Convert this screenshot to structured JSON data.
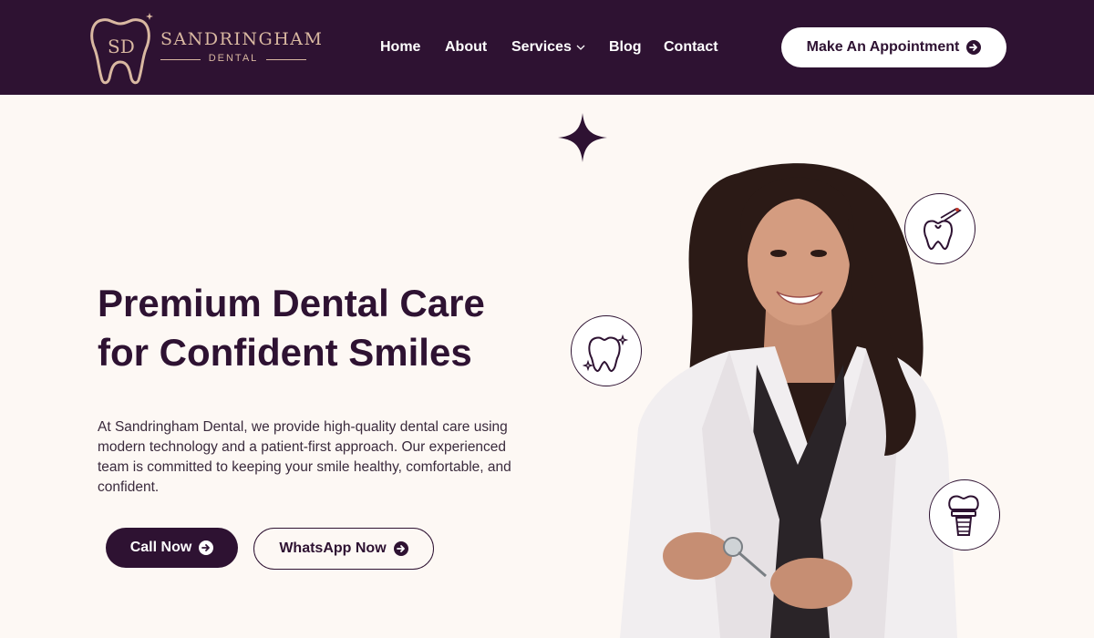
{
  "brand": {
    "name": "SANDRINGHAM",
    "sub": "DENTAL",
    "monogram": "SD"
  },
  "nav": {
    "items": [
      {
        "label": "Home"
      },
      {
        "label": "About"
      },
      {
        "label": "Services"
      },
      {
        "label": "Blog"
      },
      {
        "label": "Contact"
      }
    ],
    "cta": "Make An Appointment"
  },
  "hero": {
    "title_line1": "Premium Dental Care",
    "title_line2": "for Confident Smiles",
    "description": "At Sandringham Dental, we provide high-quality dental care using modern technology and a patient-first approach. Our experienced team is committed to keeping your smile healthy, comfortable, and confident.",
    "call_label": "Call Now",
    "whatsapp_label": "WhatsApp Now"
  },
  "icons": {
    "badge_1": "sparkling-tooth-icon",
    "badge_2": "dental-drill-tooth-icon",
    "badge_3": "dental-implant-icon"
  },
  "colors": {
    "primary": "#2e1232",
    "background": "#fdf8f4",
    "accent_gold": "#d9b8a1"
  }
}
